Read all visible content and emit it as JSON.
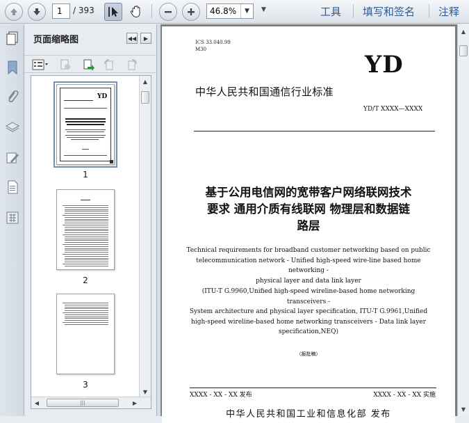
{
  "toolbar": {
    "page_current": "1",
    "page_total": "/ 393",
    "zoom_value": "46.8%",
    "menu_tools": "工具",
    "menu_sign": "填写和签名",
    "menu_comment": "注释"
  },
  "panel": {
    "title": "页面缩略图",
    "thumbnails": [
      {
        "label": "1"
      },
      {
        "label": "2"
      },
      {
        "label": "3"
      }
    ]
  },
  "document": {
    "ics_line1": "ICS  33.040.99",
    "ics_line2": "M30",
    "logo": "YD",
    "org_name": "中华人民共和国通信行业标准",
    "std_code": "YD/T XXXX—XXXX",
    "title_line1": "基于公用电信网的宽带客户网络联网技术",
    "title_line2": "要求  通用介质有线联网  物理层和数据链",
    "title_line3": "路层",
    "en_line1": "Technical requirements for broadband customer networking based on public",
    "en_line2": "telecommunication network - Unified high-speed wire-line based home networking -",
    "en_line3": "physical layer and data link layer",
    "itu_line1": "(ITU-T G.9960,Unified high-speed wireline-based home networking transceivers -",
    "itu_line2": "System architecture and physical layer specification, ITU-T G.9961,Unified",
    "itu_line3": "high-speed wireline-based home networking transceivers - Data link layer",
    "itu_line4": "specification,NEQ)",
    "draft_note": "（报批稿）",
    "publish_date": "XXXX - XX - XX 发布",
    "implement_date": "XXXX - XX - XX 实施",
    "issuer": "中华人民共和国工业和信息化部    发布"
  }
}
